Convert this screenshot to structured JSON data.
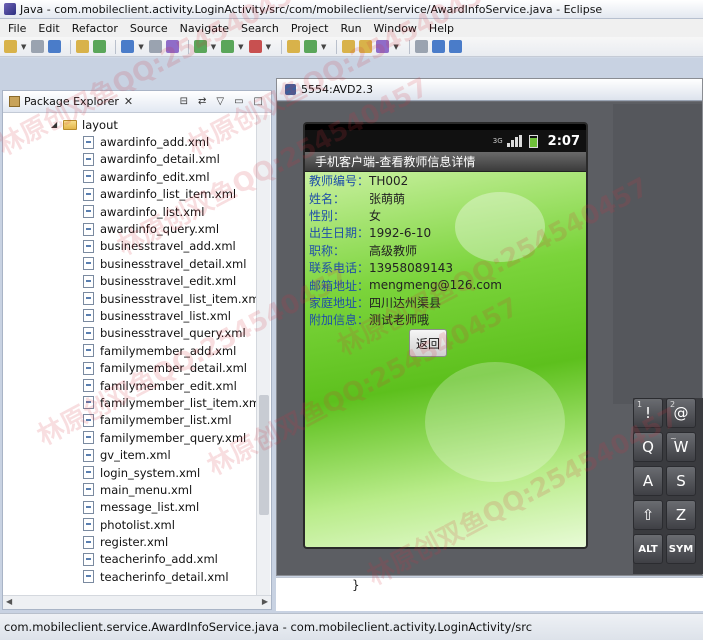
{
  "window": {
    "title": "Java - com.mobileclient.activity.LoginActivity/src/com/mobileclient/service/AwardInfoService.java - Eclipse"
  },
  "menu": [
    "File",
    "Edit",
    "Refactor",
    "Source",
    "Navigate",
    "Search",
    "Project",
    "Run",
    "Window",
    "Help"
  ],
  "package_explorer": {
    "title": "Package Explorer",
    "folder": "layout",
    "files": [
      "awardinfo_add.xml",
      "awardinfo_detail.xml",
      "awardinfo_edit.xml",
      "awardinfo_list_item.xml",
      "awardinfo_list.xml",
      "awardinfo_query.xml",
      "businesstravel_add.xml",
      "businesstravel_detail.xml",
      "businesstravel_edit.xml",
      "businesstravel_list_item.xml",
      "businesstravel_list.xml",
      "businesstravel_query.xml",
      "familymember_add.xml",
      "familymember_detail.xml",
      "familymember_edit.xml",
      "familymember_list_item.xml",
      "familymember_list.xml",
      "familymember_query.xml",
      "gv_item.xml",
      "login_system.xml",
      "main_menu.xml",
      "message_list.xml",
      "photolist.xml",
      "register.xml",
      "teacherinfo_add.xml",
      "teacherinfo_detail.xml"
    ]
  },
  "emulator": {
    "title": "5554:AVD2.3",
    "status": {
      "network": "3G",
      "time": "2:07"
    },
    "app_title": "手机客户端-查看教师信息详情",
    "fields": [
      {
        "label": "教师编号：",
        "value": "TH002"
      },
      {
        "label": "姓名：",
        "value": "张萌萌"
      },
      {
        "label": "性别：",
        "value": "女"
      },
      {
        "label": "出生日期：",
        "value": "1992-6-10"
      },
      {
        "label": "职称：",
        "value": "高级教师"
      },
      {
        "label": "联系电话：",
        "value": "13958089143"
      },
      {
        "label": "邮箱地址：",
        "value": "mengmeng@126.com"
      },
      {
        "label": "家庭地址：",
        "value": "四川达州渠县"
      },
      {
        "label": "附加信息：",
        "value": "测试老师哦"
      }
    ],
    "back_button": "返回",
    "keyboard": [
      {
        "main": "!",
        "sub": "1"
      },
      {
        "main": "@",
        "sub": "2"
      },
      {
        "main": "Q",
        "sub": ""
      },
      {
        "main": "W",
        "sub": "~"
      },
      {
        "main": "A",
        "sub": ""
      },
      {
        "main": "S",
        "sub": ""
      },
      {
        "main": "⇧",
        "sub": ""
      },
      {
        "main": "Z",
        "sub": ""
      },
      {
        "main": "ALT",
        "sub": ""
      },
      {
        "main": "SYM",
        "sub": ""
      }
    ]
  },
  "editor": {
    "visible_text": "}"
  },
  "statusbar": {
    "text": "com.mobileclient.service.AwardInfoService.java - com.mobileclient.activity.LoginActivity/src"
  },
  "watermark": "林原创双鱼QQ:254540457"
}
